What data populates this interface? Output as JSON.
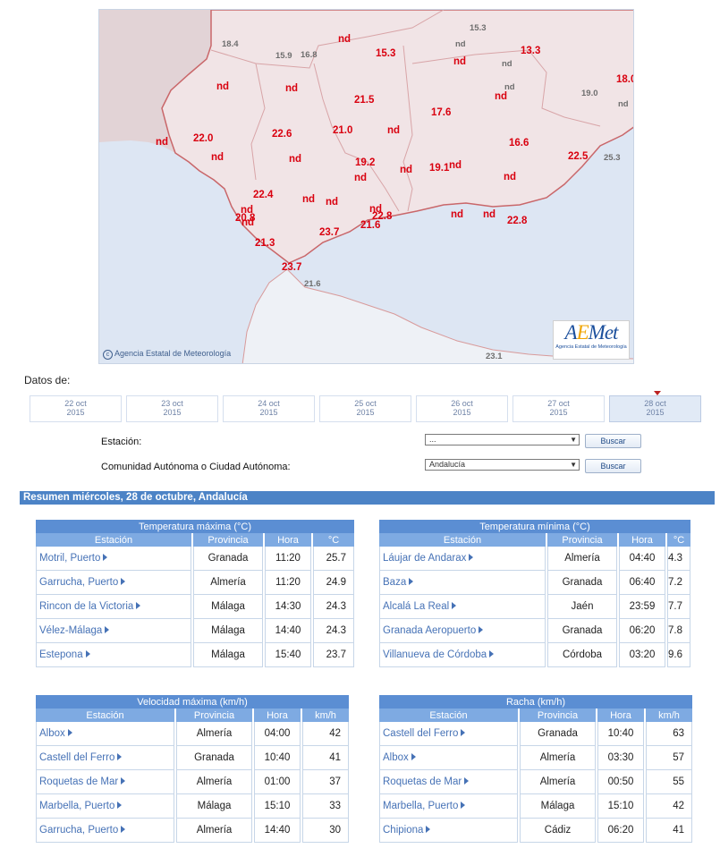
{
  "map": {
    "credit": "Agencia Estatal de Meteorología",
    "logo_text": "AEMet",
    "logo_sub": "Agencia Estatal de Meteorología",
    "labels": [
      {
        "t": "15.3",
        "c": "grey"
      },
      {
        "t": "18.4",
        "c": "grey"
      },
      {
        "t": "nd",
        "c": "grey"
      },
      {
        "t": "15.9",
        "c": "grey"
      },
      {
        "t": "16.8",
        "c": "grey"
      },
      {
        "t": "nd",
        "c": "red"
      },
      {
        "t": "15.3",
        "c": "red"
      },
      {
        "t": "nd",
        "c": "red"
      },
      {
        "t": "13.3",
        "c": "red"
      },
      {
        "t": "nd",
        "c": "grey"
      },
      {
        "t": "18.0",
        "c": "red"
      },
      {
        "t": "nd",
        "c": "red"
      },
      {
        "t": "nd",
        "c": "red"
      },
      {
        "t": "nd",
        "c": "grey"
      },
      {
        "t": "19.0",
        "c": "grey"
      },
      {
        "t": "21.5",
        "c": "red"
      },
      {
        "t": "17.6",
        "c": "red"
      },
      {
        "t": "nd",
        "c": "red"
      },
      {
        "t": "nd",
        "c": "grey"
      },
      {
        "t": "22.6",
        "c": "red"
      },
      {
        "t": "21.0",
        "c": "red"
      },
      {
        "t": "nd",
        "c": "red"
      },
      {
        "t": "22.0",
        "c": "red"
      },
      {
        "t": "nd",
        "c": "red"
      },
      {
        "t": "16.6",
        "c": "red"
      },
      {
        "t": "nd",
        "c": "red"
      },
      {
        "t": "nd",
        "c": "red"
      },
      {
        "t": "19.2",
        "c": "red"
      },
      {
        "t": "22.5",
        "c": "red"
      },
      {
        "t": "25.3",
        "c": "grey"
      },
      {
        "t": "nd",
        "c": "red"
      },
      {
        "t": "nd",
        "c": "red"
      },
      {
        "t": "19.1",
        "c": "red"
      },
      {
        "t": "nd",
        "c": "red"
      },
      {
        "t": "nd",
        "c": "red"
      },
      {
        "t": "22.4",
        "c": "red"
      },
      {
        "t": "nd",
        "c": "red"
      },
      {
        "t": "nd",
        "c": "red"
      },
      {
        "t": "nd",
        "c": "red"
      },
      {
        "t": "nd",
        "c": "red"
      },
      {
        "t": "22.8",
        "c": "red"
      },
      {
        "t": "nd",
        "c": "red"
      },
      {
        "t": "nd",
        "c": "red"
      },
      {
        "t": "20.8",
        "c": "red"
      },
      {
        "t": "nd",
        "c": "red"
      },
      {
        "t": "21.6",
        "c": "red"
      },
      {
        "t": "22.8",
        "c": "red"
      },
      {
        "t": "23.7",
        "c": "red"
      },
      {
        "t": "21.3",
        "c": "red"
      },
      {
        "t": "23.7",
        "c": "red"
      },
      {
        "t": "21.6",
        "c": "grey"
      },
      {
        "t": "23.1",
        "c": "grey"
      }
    ]
  },
  "datos_label": "Datos de:",
  "days": [
    {
      "d": "22 oct",
      "y": "2015"
    },
    {
      "d": "23 oct",
      "y": "2015"
    },
    {
      "d": "24 oct",
      "y": "2015"
    },
    {
      "d": "25 oct",
      "y": "2015"
    },
    {
      "d": "26 oct",
      "y": "2015"
    },
    {
      "d": "27 oct",
      "y": "2015"
    },
    {
      "d": "28 oct",
      "y": "2015",
      "selected": true
    }
  ],
  "form": {
    "station_label": "Estación:",
    "station_value": "...",
    "community_label": "Comunidad Autónoma o Ciudad Autónoma:",
    "community_value": "Andalucía",
    "search_label": "Buscar"
  },
  "summary_title": "Resumen miércoles, 28 de octubre, Andalucía",
  "tables": [
    {
      "title": "Temperatura máxima (°C)",
      "headers": [
        "Estación",
        "Provincia",
        "Hora",
        "°C"
      ],
      "rows": [
        [
          "Motril, Puerto",
          "Granada",
          "11:20",
          "25.7"
        ],
        [
          "Garrucha, Puerto",
          "Almería",
          "11:20",
          "24.9"
        ],
        [
          "Rincon de la Victoria",
          "Málaga",
          "14:30",
          "24.3"
        ],
        [
          "Vélez-Málaga",
          "Málaga",
          "14:40",
          "24.3"
        ],
        [
          "Estepona",
          "Málaga",
          "15:40",
          "23.7"
        ]
      ]
    },
    {
      "title": "Temperatura mínima (°C)",
      "headers": [
        "Estación",
        "Provincia",
        "Hora",
        "°C"
      ],
      "rows": [
        [
          "Láujar de Andarax",
          "Almería",
          "04:40",
          "4.3"
        ],
        [
          "Baza",
          "Granada",
          "06:40",
          "7.2"
        ],
        [
          "Alcalá La Real",
          "Jaén",
          "23:59",
          "7.7"
        ],
        [
          "Granada Aeropuerto",
          "Granada",
          "06:20",
          "7.8"
        ],
        [
          "Villanueva de Córdoba",
          "Córdoba",
          "03:20",
          "9.6"
        ]
      ]
    },
    {
      "title": "Velocidad máxima (km/h)",
      "headers": [
        "Estación",
        "Provincia",
        "Hora",
        "km/h"
      ],
      "rows": [
        [
          "Albox",
          "Almería",
          "04:00",
          "42"
        ],
        [
          "Castell del Ferro",
          "Granada",
          "10:40",
          "41"
        ],
        [
          "Roquetas de Mar",
          "Almería",
          "01:00",
          "37"
        ],
        [
          "Marbella, Puerto",
          "Málaga",
          "15:10",
          "33"
        ],
        [
          "Garrucha, Puerto",
          "Almería",
          "14:40",
          "30"
        ]
      ]
    },
    {
      "title": "Racha (km/h)",
      "headers": [
        "Estación",
        "Provincia",
        "Hora",
        "km/h"
      ],
      "rows": [
        [
          "Castell del Ferro",
          "Granada",
          "10:40",
          "63"
        ],
        [
          "Albox",
          "Almería",
          "03:30",
          "57"
        ],
        [
          "Roquetas de Mar",
          "Almería",
          "00:50",
          "55"
        ],
        [
          "Marbella, Puerto",
          "Málaga",
          "15:10",
          "42"
        ],
        [
          "Chipiona",
          "Cádiz",
          "06:20",
          "41"
        ]
      ]
    }
  ]
}
